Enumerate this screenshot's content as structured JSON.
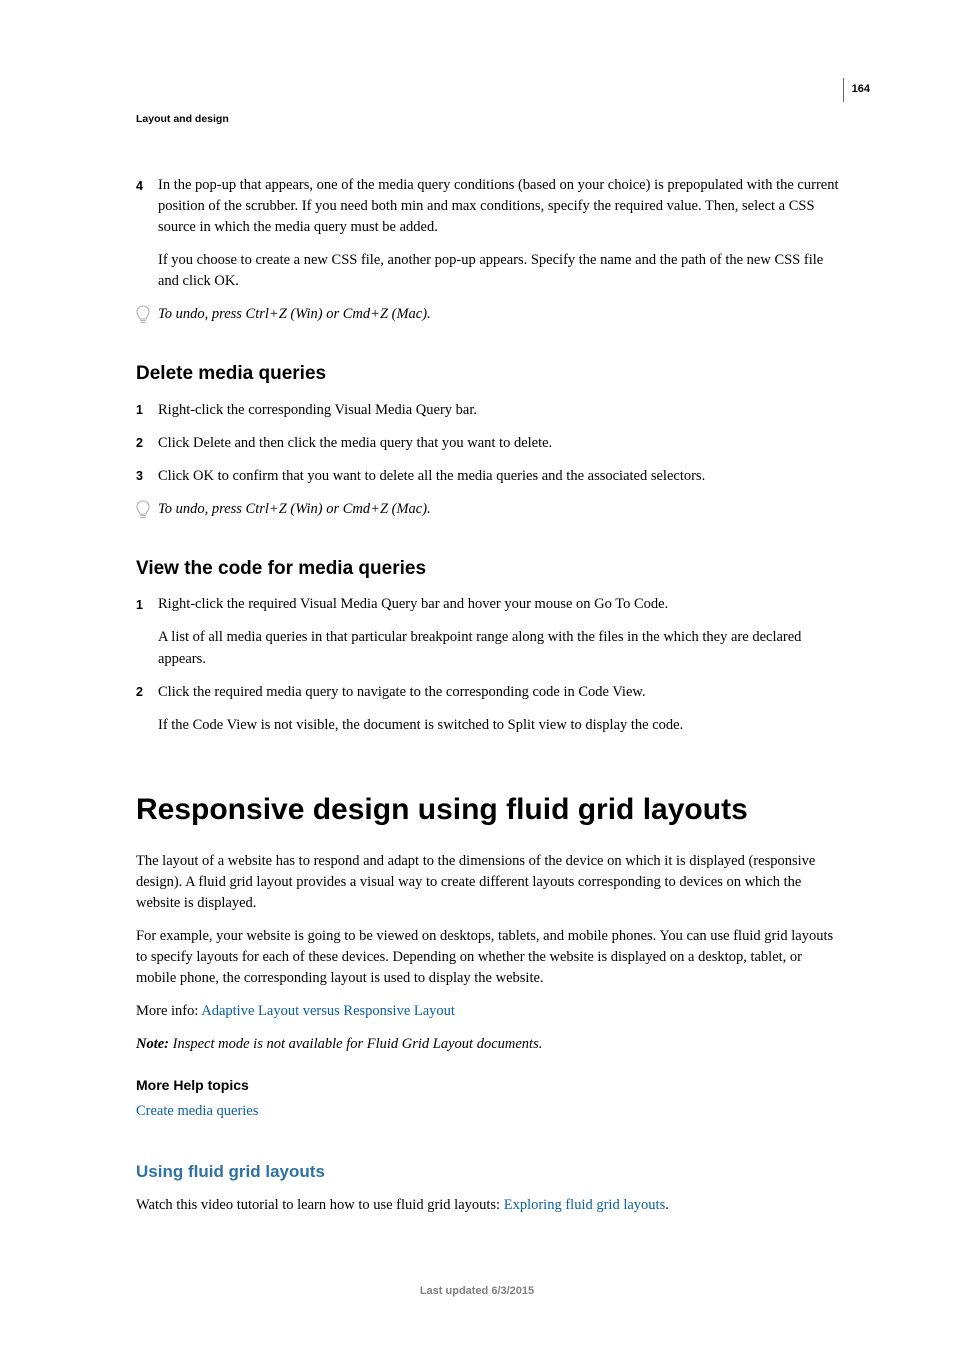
{
  "page_number": "164",
  "breadcrumb": "Layout and design",
  "step4": {
    "marker": "4",
    "p1": "In the pop-up that appears, one of the media query conditions (based on your choice) is prepopulated with the current position of the scrubber. If you need both min and max conditions, specify the required value. Then, select a CSS source in which the media query must be added.",
    "p2": "If you choose to create a new CSS file, another pop-up appears. Specify the name and the path of the new CSS file and click OK."
  },
  "tip1": "To undo, press Ctrl+Z (Win) or Cmd+Z (Mac).",
  "delete": {
    "heading": "Delete media queries",
    "s1": {
      "marker": "1",
      "text": "Right-click the corresponding Visual Media Query bar."
    },
    "s2": {
      "marker": "2",
      "text": "Click Delete and then click the media query that you want to delete."
    },
    "s3": {
      "marker": "3",
      "text": "Click OK to confirm that you want to delete all the media queries and the associated selectors."
    }
  },
  "tip2": "To undo, press Ctrl+Z (Win) or Cmd+Z (Mac).",
  "view": {
    "heading": "View the code for media queries",
    "s1": {
      "marker": "1",
      "p1": "Right-click the required Visual Media Query bar and hover your mouse on Go To Code.",
      "p2": " A list of all media queries in that particular breakpoint range along with the files in the which they are declared appears."
    },
    "s2": {
      "marker": "2",
      "p1": "Click the required media query to navigate to the corresponding code in Code View.",
      "p2": "If the Code View is not visible, the document is switched to Split view to display the code."
    }
  },
  "responsive": {
    "heading": "Responsive design using fluid grid layouts",
    "p1": "The layout of a website has to respond and adapt to the dimensions of the device on which it is displayed (responsive design). A fluid grid layout provides a visual way to create different layouts corresponding to devices on which the website is displayed.",
    "p2": "For example, your website is going to be viewed on desktops, tablets, and mobile phones. You can use fluid grid layouts to specify layouts for each of these devices. Depending on whether the website is displayed on a desktop, tablet, or mobile phone, the corresponding layout is used to display the website.",
    "moreinfo_prefix": "More info: ",
    "moreinfo_link": "Adaptive Layout versus Responsive Layout",
    "note_label": "Note: ",
    "note_text": "Inspect mode is not available for Fluid Grid Layout documents.",
    "more_help_heading": "More Help topics",
    "more_help_link": "Create media queries",
    "using_heading": "Using fluid grid layouts",
    "using_p_prefix": "Watch this video tutorial to learn how to use fluid grid layouts: ",
    "using_p_link": "Exploring fluid grid layouts",
    "using_p_suffix": "."
  },
  "footer": "Last updated 6/3/2015"
}
